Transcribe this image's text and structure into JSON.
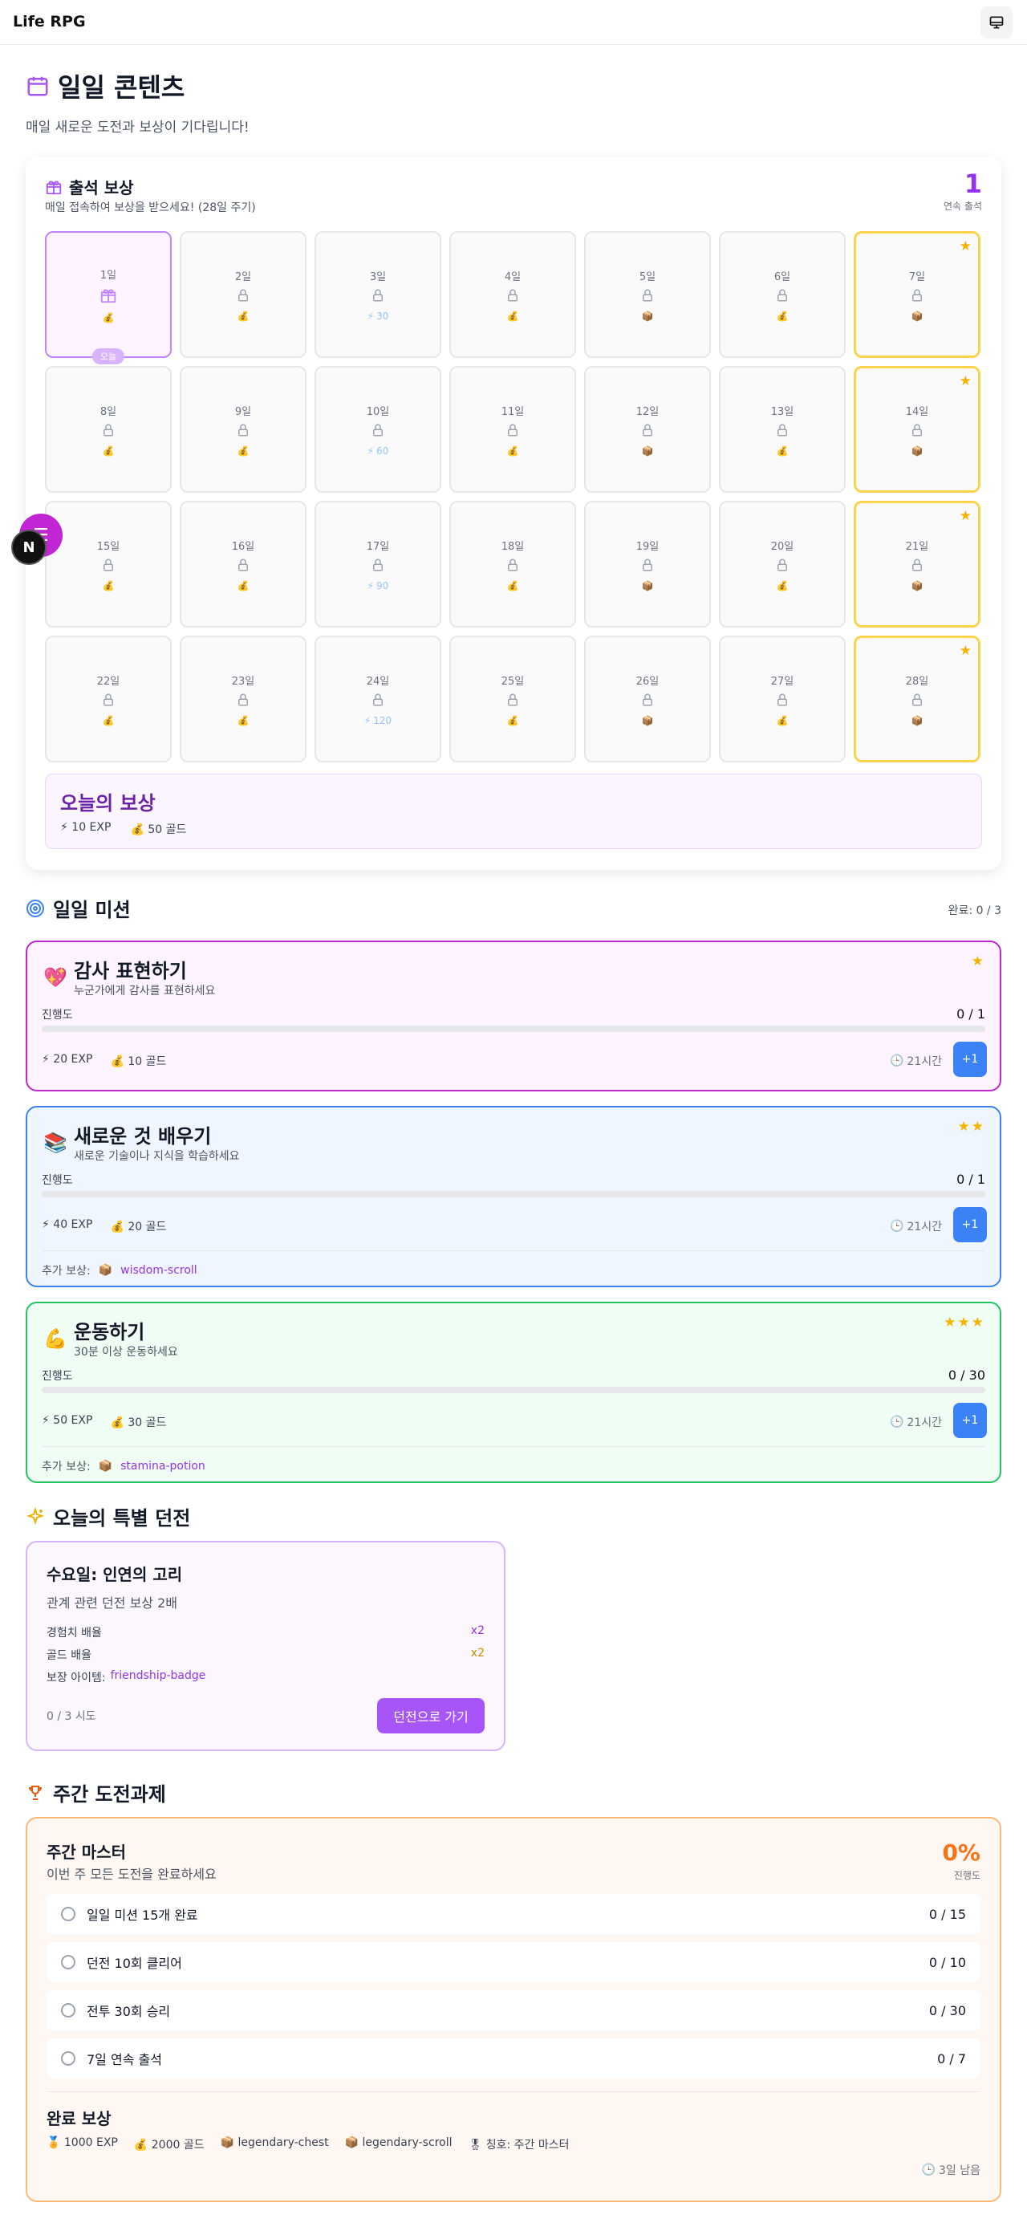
{
  "app": {
    "title": "Life RPG"
  },
  "header": {
    "title": "일일 콘텐츠",
    "subtitle": "매일 새로운 도전과 보상이 기다립니다!"
  },
  "attendance": {
    "title": "출석 보상",
    "subtitle": "매일 접속하여 보상을 받으세요! (28일 주기)",
    "streak": "1",
    "streak_label": "연속 출석",
    "today_badge": "오늘",
    "days": [
      {
        "label": "1일",
        "type": "gold"
      },
      {
        "label": "2일",
        "type": "gold"
      },
      {
        "label": "3일",
        "type": "exp",
        "value": "30"
      },
      {
        "label": "4일",
        "type": "gold"
      },
      {
        "label": "5일",
        "type": "item"
      },
      {
        "label": "6일",
        "type": "gold"
      },
      {
        "label": "7일",
        "type": "item",
        "special": true
      },
      {
        "label": "8일",
        "type": "gold"
      },
      {
        "label": "9일",
        "type": "gold"
      },
      {
        "label": "10일",
        "type": "exp",
        "value": "60"
      },
      {
        "label": "11일",
        "type": "gold"
      },
      {
        "label": "12일",
        "type": "item"
      },
      {
        "label": "13일",
        "type": "gold"
      },
      {
        "label": "14일",
        "type": "item",
        "special": true
      },
      {
        "label": "15일",
        "type": "gold"
      },
      {
        "label": "16일",
        "type": "gold"
      },
      {
        "label": "17일",
        "type": "exp",
        "value": "90"
      },
      {
        "label": "18일",
        "type": "gold"
      },
      {
        "label": "19일",
        "type": "item"
      },
      {
        "label": "20일",
        "type": "gold"
      },
      {
        "label": "21일",
        "type": "item",
        "special": true
      },
      {
        "label": "22일",
        "type": "gold"
      },
      {
        "label": "23일",
        "type": "gold"
      },
      {
        "label": "24일",
        "type": "exp",
        "value": "120"
      },
      {
        "label": "25일",
        "type": "gold"
      },
      {
        "label": "26일",
        "type": "item"
      },
      {
        "label": "27일",
        "type": "gold"
      },
      {
        "label": "28일",
        "type": "item",
        "special": true
      }
    ],
    "today_reward": {
      "title": "오늘의 보상",
      "exp": "10 EXP",
      "gold": "50 골드"
    }
  },
  "missions": {
    "title": "일일 미션",
    "completed": "완료: 0 / 3",
    "progress_label": "진행도",
    "extra_label": "추가 보상:",
    "plus_label": "+1",
    "items": [
      {
        "emoji": "💖",
        "title": "감사 표현하기",
        "desc": "누군가에게 감사를 표현하세요",
        "stars": "★",
        "progress": "0 / 1",
        "progress_value": 0,
        "exp": "20 EXP",
        "gold": "10 골드",
        "time": "21시간",
        "extra": null,
        "border": "#c026d3",
        "bg": "#fdf4ff"
      },
      {
        "emoji": "📚",
        "title": "새로운 것 배우기",
        "desc": "새로운 기술이나 지식을 학습하세요",
        "stars": "★★",
        "progress": "0 / 1",
        "progress_value": 0,
        "exp": "40 EXP",
        "gold": "20 골드",
        "time": "21시간",
        "extra": "wisdom-scroll",
        "border": "#3b82f6",
        "bg": "#eff6ff"
      },
      {
        "emoji": "💪",
        "title": "운동하기",
        "desc": "30분 이상 운동하세요",
        "stars": "★★★",
        "progress": "0 / 30",
        "progress_value": 0,
        "exp": "50 EXP",
        "gold": "30 골드",
        "time": "21시간",
        "extra": "stamina-potion",
        "border": "#22c55e",
        "bg": "#f0fdf4"
      }
    ]
  },
  "dungeon": {
    "section_title": "오늘의 특별 던전",
    "title": "수요일: 인연의 고리",
    "desc": "관계 관련 던전 보상 2배",
    "exp_label": "경험치 배율",
    "exp_value": "x2",
    "gold_label": "골드 배율",
    "gold_value": "x2",
    "item_label": "보장 아이템:",
    "item_value": "friendship-badge",
    "attempts": "0 / 3 시도",
    "button": "던전으로 가기"
  },
  "weekly": {
    "section_title": "주간 도전과제",
    "title": "주간 마스터",
    "desc": "이번 주 모든 도전을 완료하세요",
    "percent": "0%",
    "percent_label": "진행도",
    "tasks": [
      {
        "label": "일일 미션 15개 완료",
        "count": "0 / 15"
      },
      {
        "label": "던전 10회 클리어",
        "count": "0 / 10"
      },
      {
        "label": "전투 30회 승리",
        "count": "0 / 30"
      },
      {
        "label": "7일 연속 출석",
        "count": "0 / 7"
      }
    ],
    "reward_title": "완료 보상",
    "rewards": [
      "1000 EXP",
      "2000 골드",
      "legendary-chest",
      "legendary-scroll",
      "칭호: 주간 마스터"
    ],
    "time_left": "3일 남음"
  },
  "colors": {
    "accent": "#a855f7",
    "gold_star": "#f4b400",
    "blue_button": "#3b82f6",
    "weekly_orange": "#f97316"
  }
}
